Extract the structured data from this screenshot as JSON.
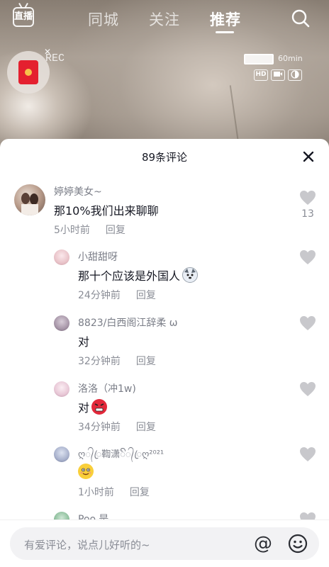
{
  "topnav": {
    "live_label": "直播",
    "tabs": [
      {
        "label": "同城",
        "active": false
      },
      {
        "label": "关注",
        "active": false
      },
      {
        "label": "推荐",
        "active": true
      }
    ],
    "search_icon": "search-icon"
  },
  "video_overlay": {
    "rec_label": "REC",
    "battery_text": "60min",
    "hud_badges": [
      "HD",
      "camera",
      "contrast"
    ],
    "red_packet_icon": "red-envelope-icon"
  },
  "comments_panel": {
    "title": "89条评论",
    "close_icon": "close-icon",
    "comments": [
      {
        "username": "婷婷美女~",
        "text": "那10%我们出来聊聊",
        "time": "5小时前",
        "reply_label": "回复",
        "like_count": "13",
        "level": 0
      },
      {
        "username": "小甜甜呀",
        "text": "那十个应该是外国人",
        "emoji": "dog-face-emoji",
        "time": "24分钟前",
        "reply_label": "回复",
        "level": 1
      },
      {
        "username": "8823/白西阁江辞柔 ω",
        "text": "对",
        "time": "32分钟前",
        "reply_label": "回复",
        "level": 1
      },
      {
        "username": "洛洛（冲1w)",
        "text": "对",
        "emoji": "angry-face-emoji",
        "time": "34分钟前",
        "reply_label": "回复",
        "level": 1
      },
      {
        "username": "ღ᭄ꦿ鞫潇ꦼ᭄ꦿღ²⁰²¹",
        "text": "",
        "emoji": "smiling-face-emoji",
        "time": "1小时前",
        "reply_label": "回复",
        "level": 1
      },
      {
        "username": "Poo.是",
        "text": "",
        "time": "",
        "reply_label": "",
        "level": 1
      }
    ]
  },
  "input_bar": {
    "placeholder": "有爱评论，说点儿好听的~",
    "at_label": "@",
    "emoji_icon": "emoji-icon"
  },
  "colors": {
    "sheet_bg": "#ffffff",
    "text_primary": "#161823",
    "text_secondary": "#8a8d96",
    "like_gray": "#c8c8cc",
    "red_packet": "#e4202f"
  }
}
